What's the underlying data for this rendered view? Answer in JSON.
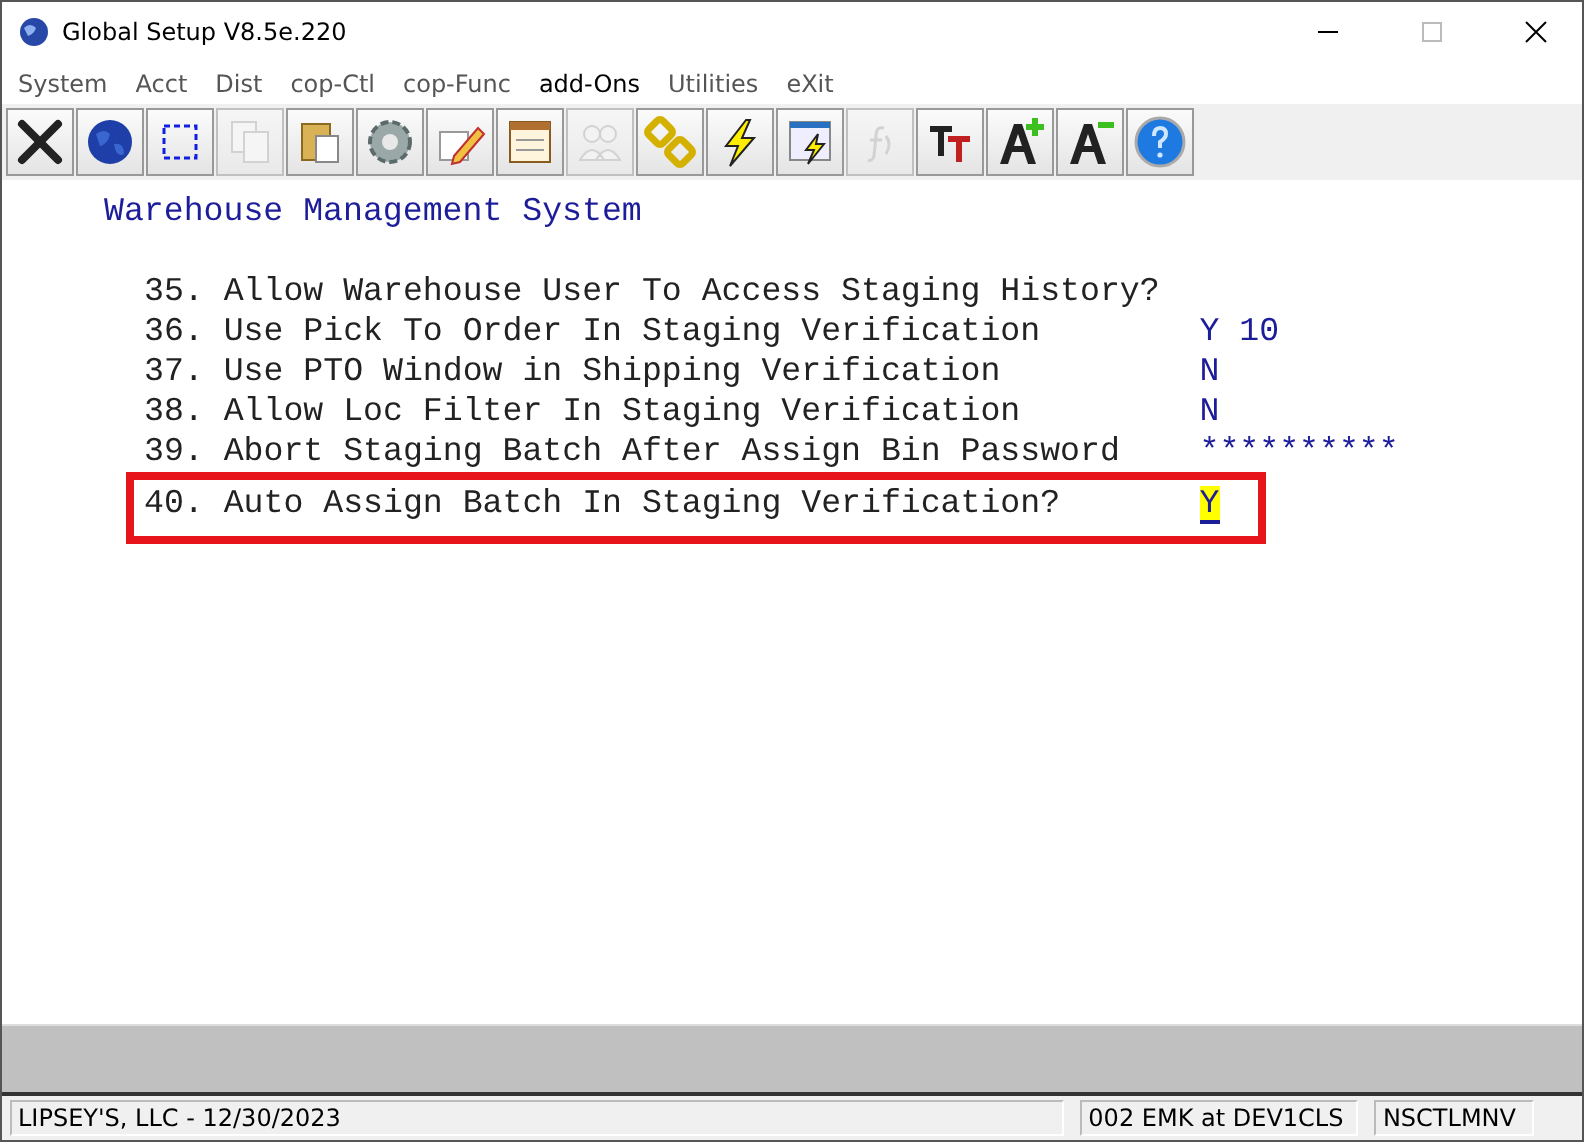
{
  "window": {
    "title": "Global Setup V8.5e.220"
  },
  "menu": [
    {
      "label": "System",
      "selected": false
    },
    {
      "label": "Acct",
      "selected": false
    },
    {
      "label": "Dist",
      "selected": false
    },
    {
      "label": "cop-Ctl",
      "selected": false
    },
    {
      "label": "cop-Func",
      "selected": false
    },
    {
      "label": "add-Ons",
      "selected": true
    },
    {
      "label": "Utilities",
      "selected": false
    },
    {
      "label": "eXit",
      "selected": false
    }
  ],
  "toolbar": [
    {
      "kind": "close",
      "disabled": false
    },
    {
      "kind": "globe",
      "disabled": false
    },
    {
      "kind": "select",
      "disabled": false
    },
    {
      "kind": "copy",
      "disabled": true
    },
    {
      "kind": "paste",
      "disabled": false
    },
    {
      "kind": "gear",
      "disabled": false
    },
    {
      "kind": "edit",
      "disabled": false
    },
    {
      "kind": "form",
      "disabled": false
    },
    {
      "kind": "users",
      "disabled": true
    },
    {
      "kind": "link",
      "disabled": false
    },
    {
      "kind": "bolt",
      "disabled": false
    },
    {
      "kind": "window-bolt",
      "disabled": false
    },
    {
      "kind": "function",
      "disabled": true
    },
    {
      "kind": "font",
      "disabled": false
    },
    {
      "kind": "font-bigger",
      "disabled": false
    },
    {
      "kind": "font-smaller",
      "disabled": false
    },
    {
      "kind": "help",
      "disabled": false
    }
  ],
  "screen_title": "Warehouse Management System",
  "options": [
    {
      "number": "35.",
      "label": "Allow Warehouse User To Access Staging History?"
    },
    {
      "number": "36.",
      "label": "Use Pick To Order In Staging Verification",
      "value": "Y 10"
    },
    {
      "number": "37.",
      "label": "Use PTO Window in Shipping Verification",
      "value": "N"
    },
    {
      "number": "38.",
      "label": "Allow Loc Filter In Staging Verification",
      "value": "N"
    },
    {
      "number": "39.",
      "label": "Abort Staging Batch After Assign Bin Password",
      "value": "**********"
    },
    {
      "number": "40.",
      "label": "Auto Assign Batch In Staging Verification?",
      "value": "Y",
      "highlighted": true,
      "cursor": true
    }
  ],
  "status_bar": [
    "LIPSEY'S, LLC - 12/30/2023",
    "002 EMK at DEV1CLS",
    "NSCTLMNV"
  ]
}
